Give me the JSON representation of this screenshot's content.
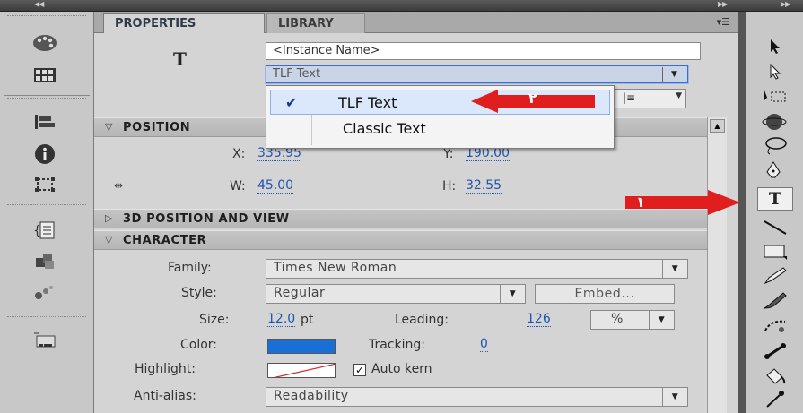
{
  "tabs": {
    "properties": "PROPERTIES",
    "library": "LIBRARY"
  },
  "instance": {
    "symbol": "T",
    "name_placeholder": "<Instance Name>",
    "text_type": "TLF Text"
  },
  "dropdown": {
    "options": [
      "TLF Text",
      "Classic Text"
    ],
    "selected": "TLF Text"
  },
  "annotations": {
    "arrow1": "١",
    "arrow2": "٢",
    "arrow_color": "#e11e1e"
  },
  "position": {
    "header": "POSITION",
    "x_label": "X:",
    "x_value": "335.95",
    "y_label": "Y:",
    "y_value": "190.00",
    "w_label": "W:",
    "w_value": "45.00",
    "h_label": "H:",
    "h_value": "32.55"
  },
  "section_3d": {
    "header": "3D POSITION AND VIEW"
  },
  "character": {
    "header": "CHARACTER",
    "family_label": "Family:",
    "family_value": "Times New Roman",
    "style_label": "Style:",
    "style_value": "Regular",
    "embed_button": "Embed...",
    "size_label": "Size:",
    "size_value": "12.0",
    "size_unit": "pt",
    "leading_label": "Leading:",
    "leading_value": "126",
    "leading_unit": "%",
    "color_label": "Color:",
    "color_value": "#1a6fd6",
    "tracking_label": "Tracking:",
    "tracking_value": "0",
    "highlight_label": "Highlight:",
    "autokern_label": "Auto kern",
    "autokern_checked": true,
    "antialias_label": "Anti-alias:",
    "antialias_value": "Readability"
  },
  "toolbar": {
    "left_icons": [
      "color-swatches-icon",
      "grid-icon",
      "align-icon",
      "info-icon",
      "transform-icon",
      "code-snippet-icon",
      "components-icon",
      "motion-presets-icon",
      "project-icon"
    ],
    "right_icons": [
      "selection-tool-icon",
      "subselection-tool-icon",
      "free-transform-icon",
      "3d-rotation-icon",
      "lasso-icon",
      "pen-tool-icon",
      "text-tool-icon",
      "line-tool-icon",
      "rectangle-tool-icon",
      "pencil-tool-icon",
      "brush-tool-icon",
      "deco-tool-icon",
      "bone-tool-icon",
      "paint-bucket-icon",
      "eyedropper-icon"
    ],
    "selected_tool": "text-tool-icon"
  }
}
